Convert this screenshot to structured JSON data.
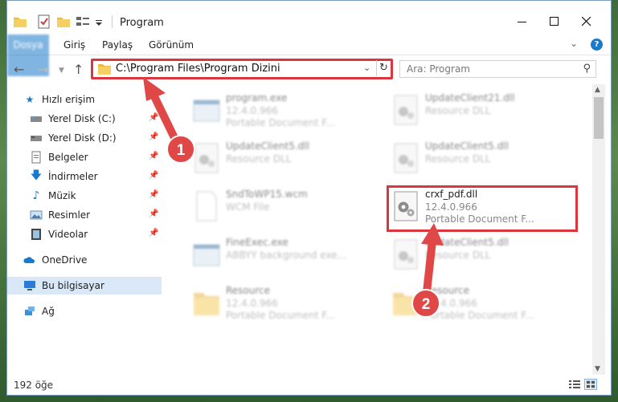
{
  "window": {
    "title": "Program"
  },
  "ribbon": {
    "tabs": [
      "Dosya",
      "Giriş",
      "Paylaş",
      "Görünüm"
    ]
  },
  "nav": {
    "address": "C:\\Program Files\\Program Dizini",
    "search_placeholder": "Ara: Program"
  },
  "sidebar": {
    "items": [
      {
        "label": "Hızlı erişim",
        "icon": "star-icon"
      },
      {
        "label": "Yerel Disk (C:)",
        "icon": "drive-icon"
      },
      {
        "label": "Yerel Disk (D:)",
        "icon": "drive-icon"
      },
      {
        "label": "Belgeler",
        "icon": "documents-icon"
      },
      {
        "label": "İndirmeler",
        "icon": "download-icon"
      },
      {
        "label": "Müzik",
        "icon": "music-icon"
      },
      {
        "label": "Resimler",
        "icon": "pictures-icon"
      },
      {
        "label": "Videolar",
        "icon": "videos-icon"
      },
      {
        "label": "OneDrive",
        "icon": "cloud-icon"
      },
      {
        "label": "Bu bilgisayar",
        "icon": "computer-icon"
      },
      {
        "label": "Ağ",
        "icon": "network-icon"
      }
    ]
  },
  "files": [
    {
      "name": "program.exe",
      "line2": "12.4.0.966",
      "line3": "Portable Document F...",
      "icon": "exe-icon"
    },
    {
      "name": "UpdateClient21.dll",
      "line2": "Resource DLL",
      "line3": "",
      "icon": "dll-gear-icon"
    },
    {
      "name": "UpdateClient5.dll",
      "line2": "Resource DLL",
      "line3": "",
      "icon": "dll-gear-icon"
    },
    {
      "name": "UpdateClient5.dll",
      "line2": "Resource DLL",
      "line3": "",
      "icon": "dll-gear-icon"
    },
    {
      "name": "SndToWP15.wcm",
      "line2": "WCM File",
      "line3": "",
      "icon": "blank-file-icon"
    },
    {
      "name": "crxf_pdf.dll",
      "line2": "12.4.0.966",
      "line3": "Portable Document F...",
      "icon": "dll-gear-icon"
    },
    {
      "name": "FineExec.exe",
      "line2": "ABBYY background exe...",
      "line3": "",
      "icon": "exe-icon"
    },
    {
      "name": "UpdateClient5.dll",
      "line2": "Resource DLL",
      "line3": "",
      "icon": "dll-gear-icon"
    },
    {
      "name": "Resource",
      "line2": "12.4.0.966",
      "line3": "Portable Document F...",
      "icon": "folder-icon"
    },
    {
      "name": "Resource",
      "line2": "12.4.0.966",
      "line3": "Portable Document F...",
      "icon": "folder-icon"
    }
  ],
  "status": {
    "count": "192 öğe"
  },
  "callouts": [
    {
      "number": "1"
    },
    {
      "number": "2"
    }
  ],
  "colors": {
    "accent": "#1979ca",
    "highlight": "#d9363e",
    "selection": "#d9e7f6"
  }
}
